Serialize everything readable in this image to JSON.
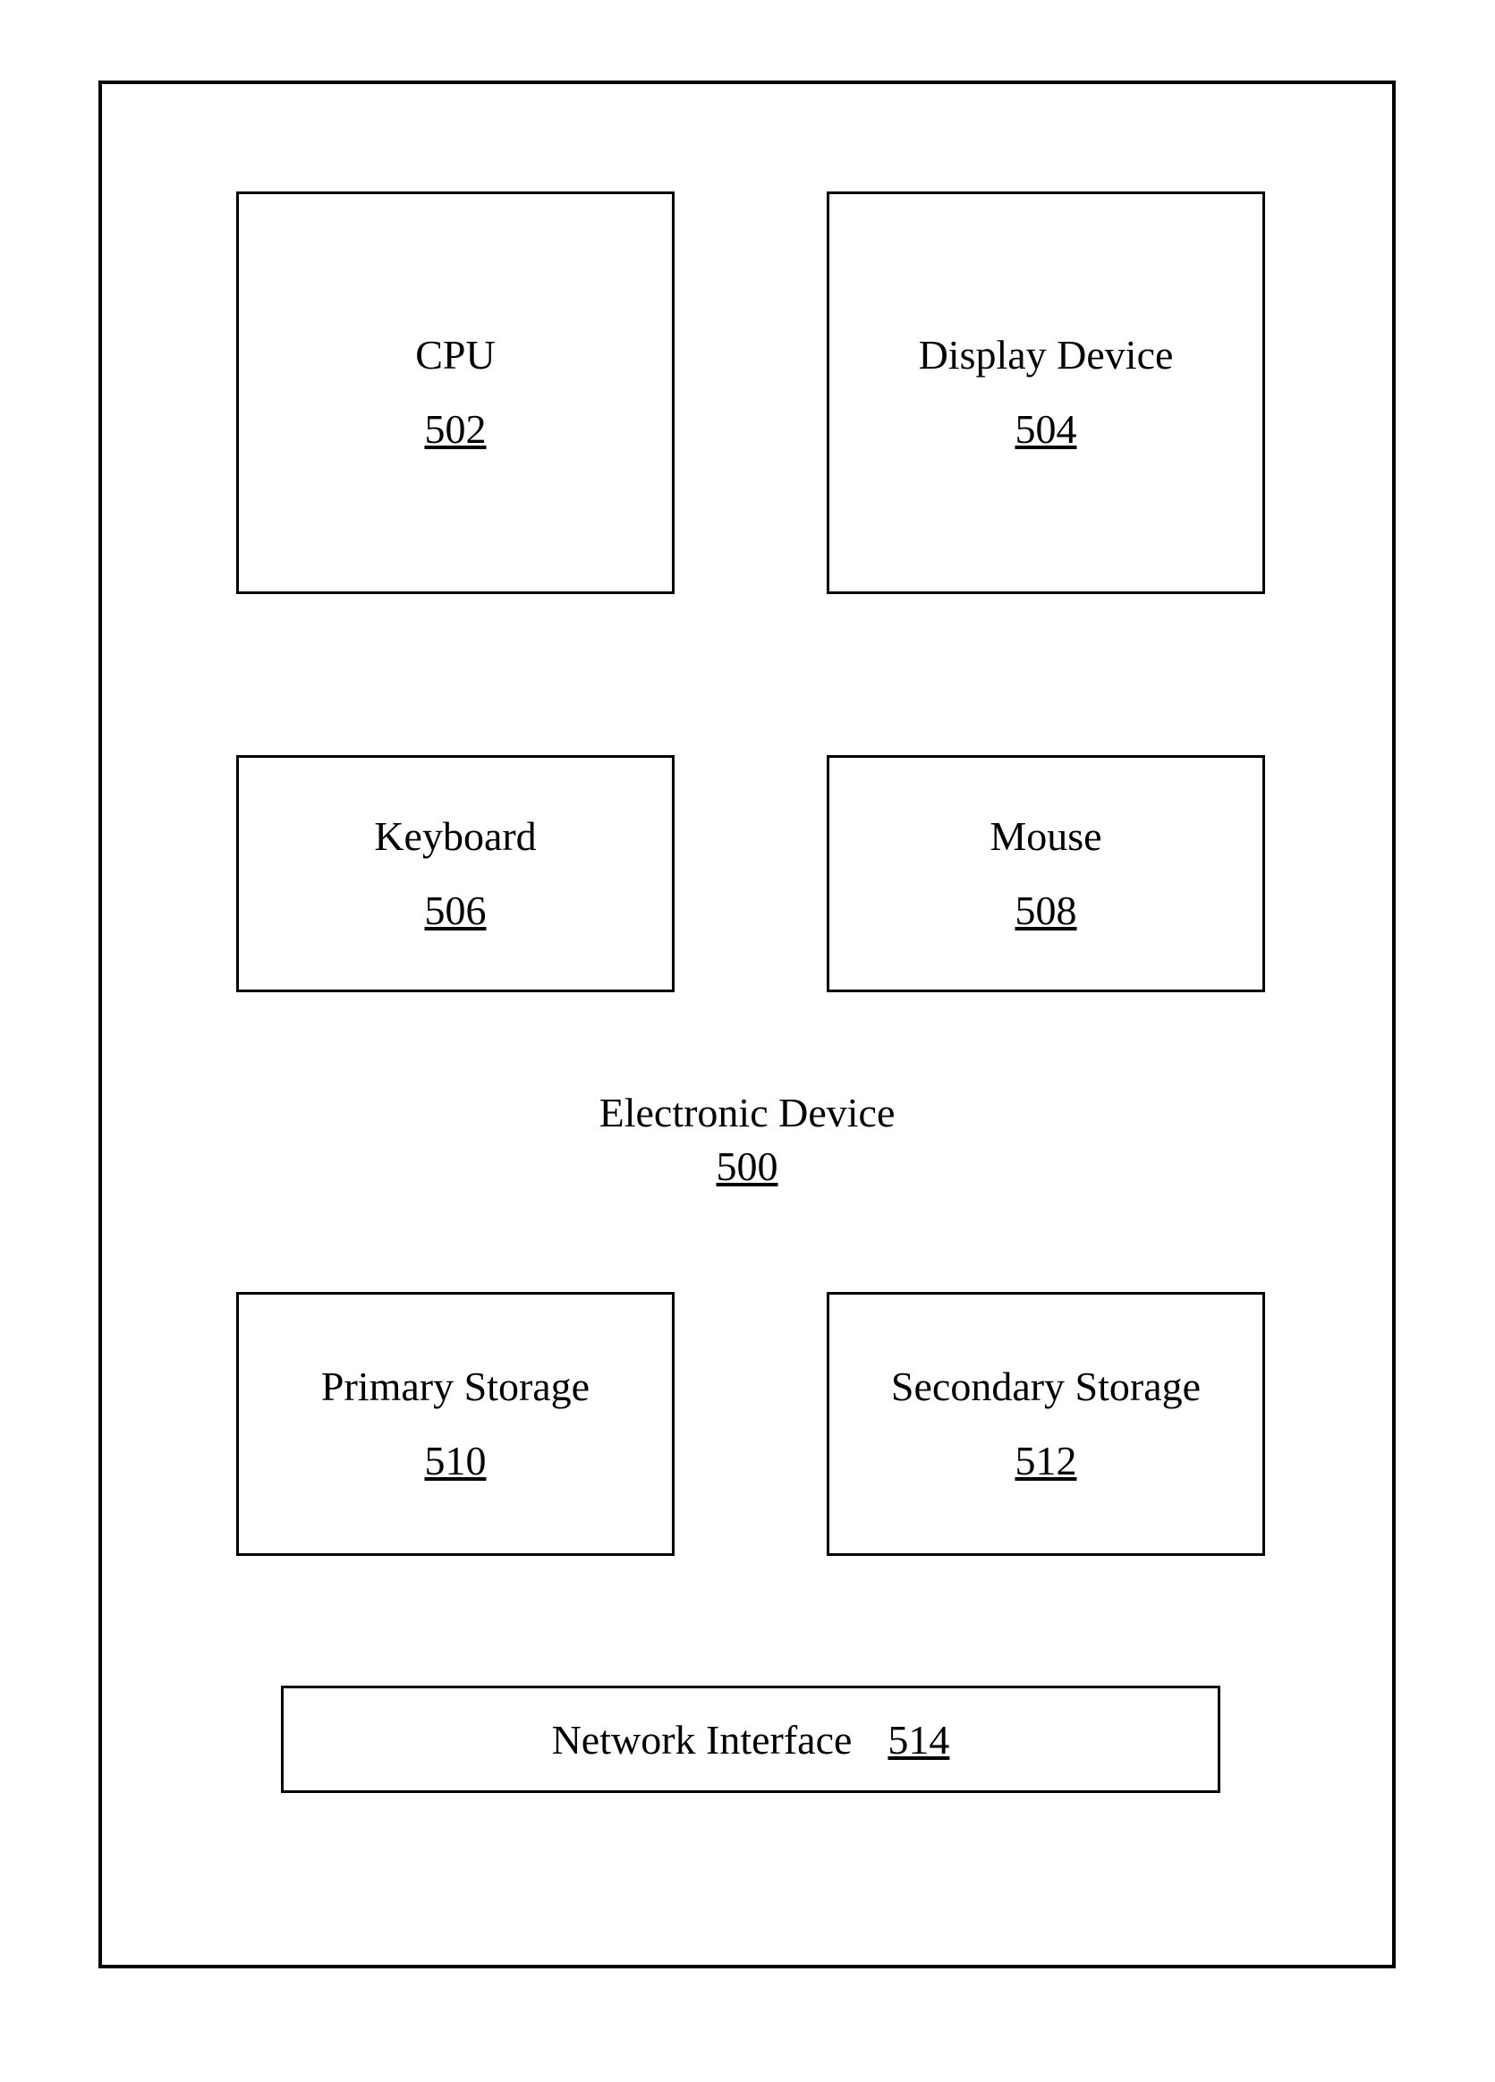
{
  "container": {
    "name": "Electronic Device",
    "ref": "500"
  },
  "blocks": {
    "cpu": {
      "name": "CPU",
      "ref": "502"
    },
    "disp": {
      "name": "Display Device",
      "ref": "504"
    },
    "kbd": {
      "name": "Keyboard",
      "ref": "506"
    },
    "mouse": {
      "name": "Mouse",
      "ref": "508"
    },
    "pri": {
      "name": "Primary Storage",
      "ref": "510"
    },
    "sec": {
      "name": "Secondary Storage",
      "ref": "512"
    },
    "net": {
      "name": "Network Interface",
      "ref": "514"
    }
  }
}
